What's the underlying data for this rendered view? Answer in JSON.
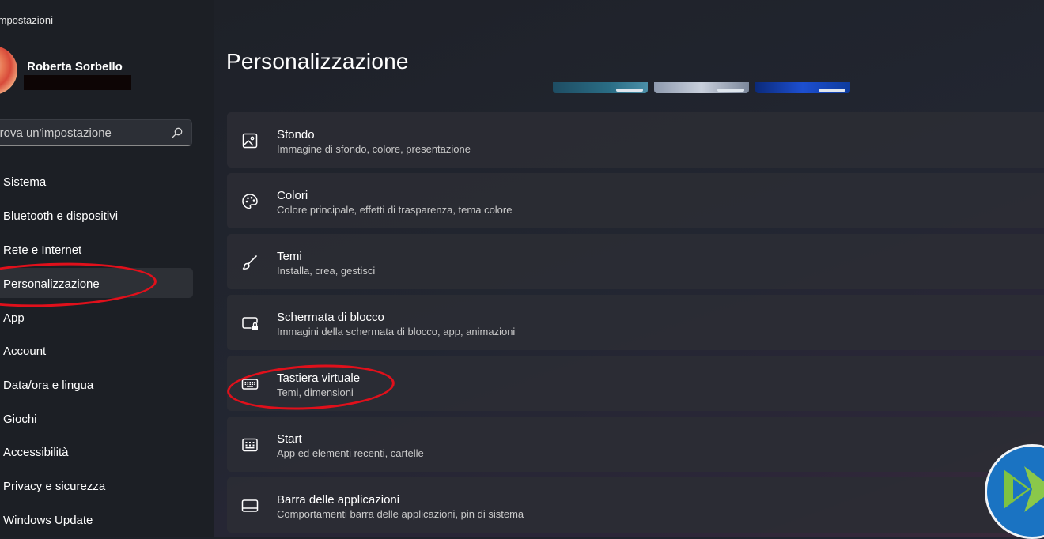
{
  "app": {
    "title": "Impostazioni"
  },
  "user": {
    "name": "Roberta Sorbello"
  },
  "search": {
    "placeholder": "Trova un'impostazione"
  },
  "sidebar": {
    "items": [
      {
        "label": "Sistema",
        "selected": false
      },
      {
        "label": "Bluetooth e dispositivi",
        "selected": false
      },
      {
        "label": "Rete e Internet",
        "selected": false
      },
      {
        "label": "Personalizzazione",
        "selected": true
      },
      {
        "label": "App",
        "selected": false
      },
      {
        "label": "Account",
        "selected": false
      },
      {
        "label": "Data/ora e lingua",
        "selected": false
      },
      {
        "label": "Giochi",
        "selected": false
      },
      {
        "label": "Accessibilità",
        "selected": false
      },
      {
        "label": "Privacy e sicurezza",
        "selected": false
      },
      {
        "label": "Windows Update",
        "selected": false
      }
    ]
  },
  "main": {
    "title": "Personalizzazione",
    "cards": [
      {
        "title": "Sfondo",
        "subtitle": "Immagine di sfondo, colore, presentazione",
        "icon": "image-icon"
      },
      {
        "title": "Colori",
        "subtitle": "Colore principale, effetti di trasparenza, tema colore",
        "icon": "palette-icon"
      },
      {
        "title": "Temi",
        "subtitle": "Installa, crea, gestisci",
        "icon": "brush-icon"
      },
      {
        "title": "Schermata di blocco",
        "subtitle": "Immagini della schermata di blocco, app, animazioni",
        "icon": "lock-screen-icon"
      },
      {
        "title": "Tastiera virtuale",
        "subtitle": "Temi, dimensioni",
        "icon": "keyboard-icon"
      },
      {
        "title": "Start",
        "subtitle": "App ed elementi recenti, cartelle",
        "icon": "start-icon"
      },
      {
        "title": "Barra delle applicazioni",
        "subtitle": "Comportamenti barra delle applicazioni, pin di sistema",
        "icon": "taskbar-icon"
      }
    ]
  },
  "colors": {
    "annotation": "#e0101b",
    "sidebar_bg": "#1c1f25",
    "card_bg": "#2b2d34",
    "selected_bg": "#2d3036"
  }
}
